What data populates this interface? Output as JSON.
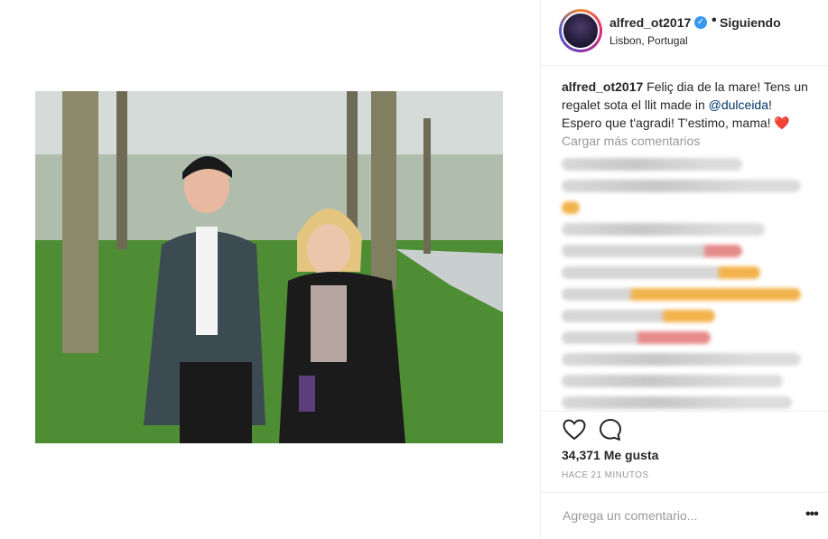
{
  "post": {
    "username": "alfred_ot2017",
    "follow_status": "Siguiendo",
    "location": "Lisbon, Portugal",
    "caption_user": "alfred_ot2017",
    "caption_text_1": "Feliç dia de la mare! Tens un regalet sota el llit made in ",
    "caption_mention": "@dulceida",
    "caption_text_2": "! Espero que t'agradi! T'estimo, mama! ",
    "caption_emoji": "❤️",
    "load_more": "Cargar más comentarios",
    "likes": "34,371 Me gusta",
    "time_ago": "HACE 21 MINUTOS",
    "comment_placeholder": "Agrega un comentario...",
    "more_options": "•••"
  },
  "icons": {
    "verified": "verified-badge-icon",
    "like": "heart-outline-icon",
    "comment": "comment-bubble-icon",
    "more": "more-options-icon"
  },
  "colors": {
    "accent_blue": "#3897f0",
    "mention_blue": "#003569",
    "muted_text": "#999999",
    "border": "#efefef"
  }
}
